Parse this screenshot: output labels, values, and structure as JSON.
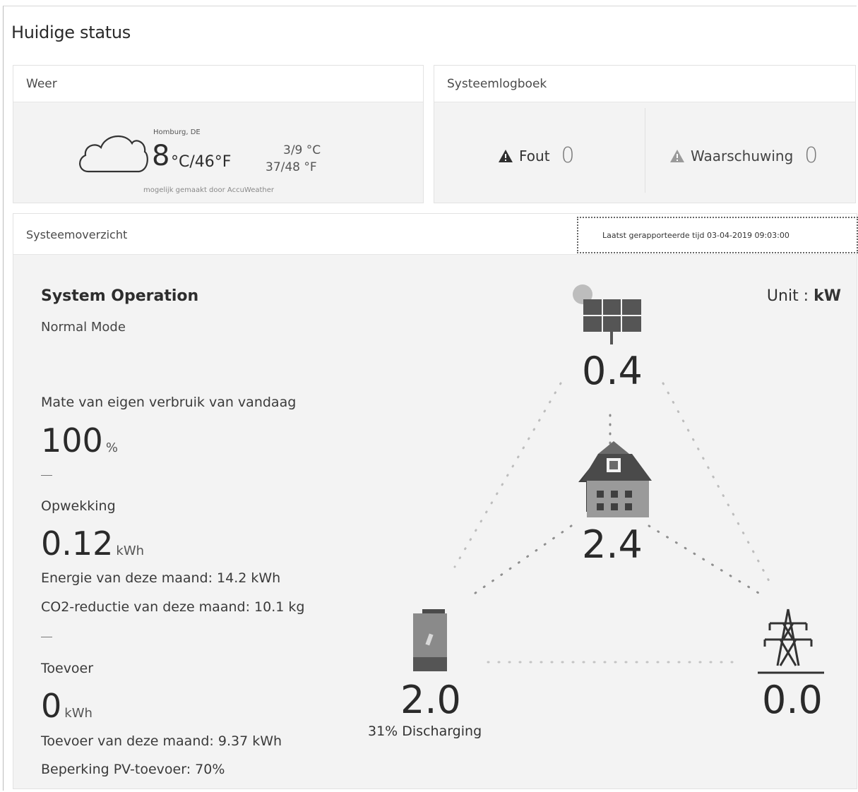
{
  "page": {
    "title": "Huidige status"
  },
  "weather": {
    "header": "Weer",
    "location": "Homburg, DE",
    "temp_c": "8",
    "temp_rest": "°C/46°F",
    "minmax_c": "3/9 °C",
    "minmax_f": "37/48 °F",
    "credit": "mogelijk gemaakt door AccuWeather",
    "icon": "cloud-icon"
  },
  "syslog": {
    "header": "Systeemlogboek",
    "error_label": "Fout",
    "error_count": "0",
    "warning_label": "Waarschuwing",
    "warning_count": "0"
  },
  "overview": {
    "header": "Systeemoverzicht",
    "last_report": "Laatst gerapporteerde tijd 03-04-2019 09:03:00",
    "operation_title": "System Operation",
    "mode": "Normal Mode",
    "unit_label": "Unit : ",
    "unit_value": "kW",
    "self_consumption": {
      "label": "Mate van eigen verbruik van vandaag",
      "value": "100",
      "unit": "%"
    },
    "generation": {
      "label": "Opwekking",
      "value": "0.12",
      "unit": "kWh",
      "month_energy": "Energie van deze maand: 14.2 kWh",
      "month_co2": "CO2-reductie van deze maand: 10.1 kg"
    },
    "feed_in": {
      "label": "Toevoer",
      "value": "0",
      "unit": "kWh",
      "month_feed": "Toevoer van deze maand: 9.37 kWh",
      "limit": "Beperking PV-toevoer: 70%"
    },
    "flow": {
      "pv": "0.4",
      "house": "2.4",
      "battery": "2.0",
      "battery_status": "31% Discharging",
      "grid": "0.0"
    },
    "colors": {
      "panel_bg": "#f3f3f3",
      "dots": "#9a9a9a"
    }
  }
}
